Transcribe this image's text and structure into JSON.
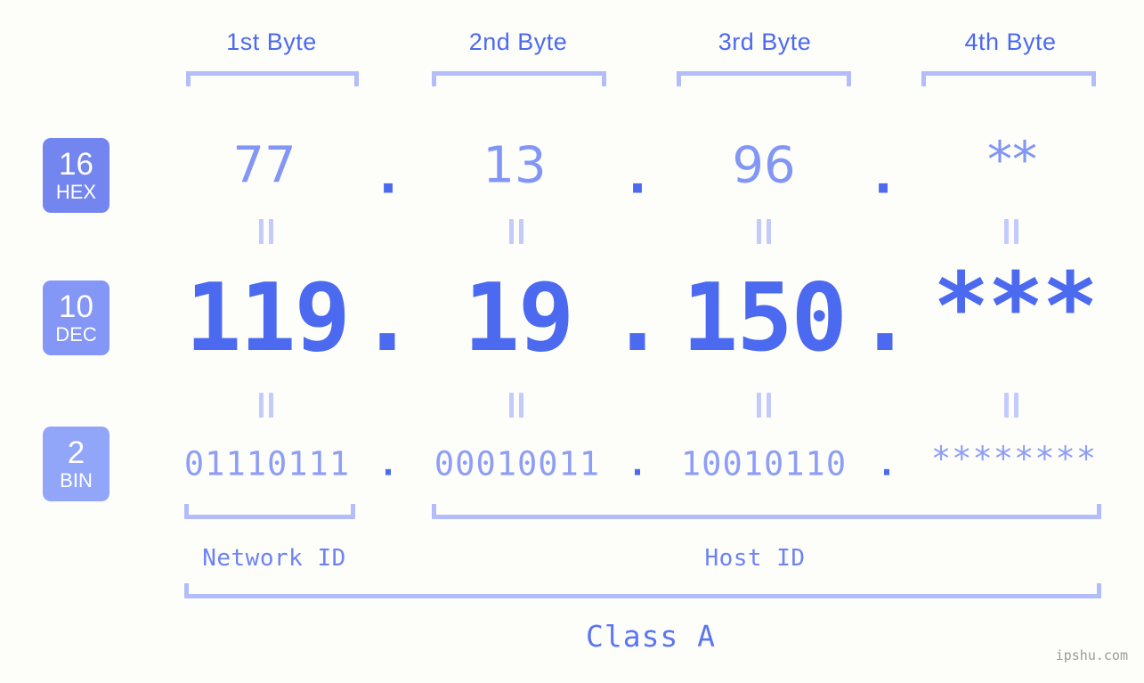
{
  "meta": {
    "background_color": "#fdfdfa",
    "accent_color": "#4c6af0",
    "light_accent_color": "#b3bdfb",
    "watermark": "ipshu.com"
  },
  "byte_headers": [
    {
      "label": "1st Byte"
    },
    {
      "label": "2nd Byte"
    },
    {
      "label": "3rd Byte"
    },
    {
      "label": "4th Byte"
    }
  ],
  "bases": [
    {
      "number": "16",
      "name": "HEX",
      "color": "#7385ee"
    },
    {
      "number": "10",
      "name": "DEC",
      "color": "#8496f6"
    },
    {
      "number": "2",
      "name": "BIN",
      "color": "#92a6f9"
    }
  ],
  "rows": {
    "hex": {
      "base_label": "HEX",
      "values": [
        "77",
        "13",
        "96",
        "**"
      ],
      "separator": "."
    },
    "dec": {
      "base_label": "DEC",
      "values": [
        "119",
        "19",
        "150",
        "***"
      ],
      "separator": "."
    },
    "bin": {
      "base_label": "BIN",
      "values": [
        "01110111",
        "00010011",
        "10010110",
        "********"
      ],
      "separator": "."
    }
  },
  "equals_marks": {
    "glyph": "||",
    "count_per_gap": 4
  },
  "segments": {
    "network_id": "Network ID",
    "host_id": "Host ID",
    "class": "Class A"
  }
}
